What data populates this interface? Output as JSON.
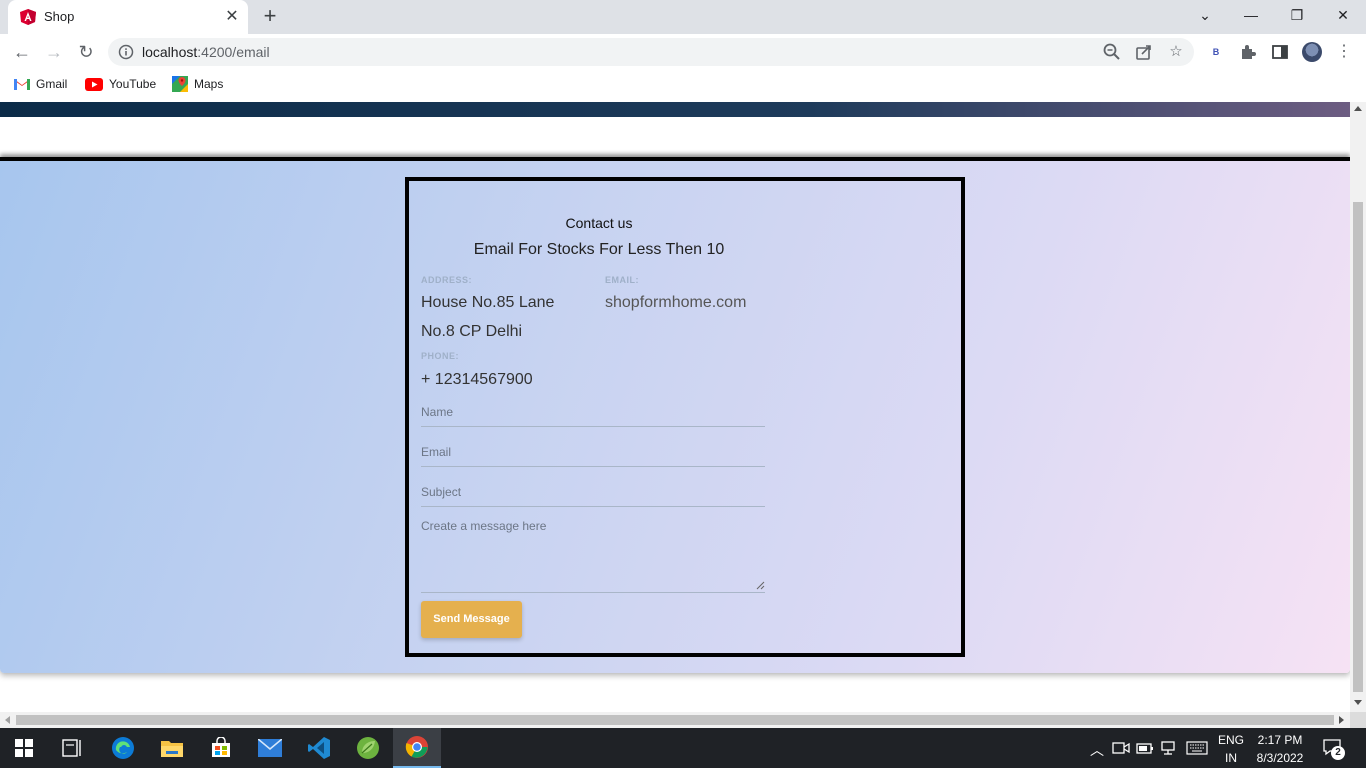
{
  "browser": {
    "tab_title": "Shop",
    "url_host": "localhost",
    "url_rest": ":4200/email",
    "extension_badge": "B"
  },
  "bookmarks": [
    {
      "label": "Gmail"
    },
    {
      "label": "YouTube"
    },
    {
      "label": "Maps"
    }
  ],
  "page": {
    "contact_heading": "Contact us",
    "subheading": "Email For Stocks For Less Then 10",
    "address_label": "ADDRESS:",
    "address_line1": "House No.85 Lane",
    "address_line2": "No.8 CP Delhi",
    "email_label": "EMAIL:",
    "email_value": "shopformhome.com",
    "phone_label": "PHONE:",
    "phone_value": "+ 12314567900",
    "form": {
      "name_placeholder": "Name",
      "email_placeholder": "Email",
      "subject_placeholder": "Subject",
      "message_placeholder": "Create a message here",
      "send_label": "Send Message"
    },
    "colors": {
      "accent_button": "#e5b04e",
      "gradient_start": "#a7c6ee",
      "gradient_end": "#f6e2f4"
    }
  },
  "taskbar": {
    "lang_line1": "ENG",
    "lang_line2": "IN",
    "time": "2:17 PM",
    "date": "8/3/2022",
    "notification_count": "2"
  }
}
